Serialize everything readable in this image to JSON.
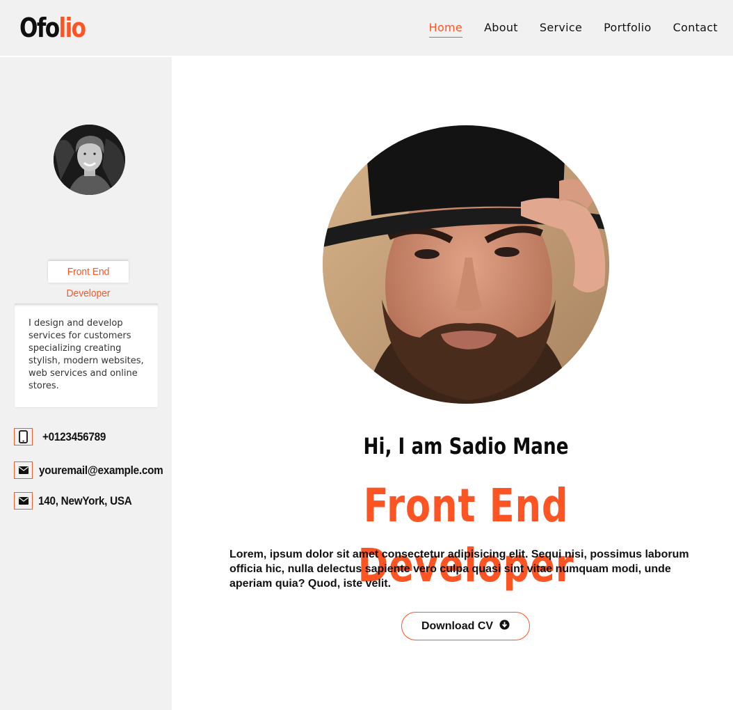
{
  "header": {
    "logo_part1": "Ofo",
    "logo_part2": "lio",
    "nav": [
      "Home",
      "About",
      "Service",
      "Portfolio",
      "Contact"
    ],
    "active_nav": "Home"
  },
  "sidebar": {
    "role": "Front End Developer",
    "bio": "I design and develop services for customers specializing creating stylish, modern websites, web services and online stores.",
    "contacts": [
      {
        "icon": "phone-icon",
        "text": "+0123456789"
      },
      {
        "icon": "envelope-icon",
        "text": "youremail@example.com"
      },
      {
        "icon": "envelope-icon",
        "text": "140, NewYork, USA"
      }
    ]
  },
  "hero": {
    "greeting": "Hi, I am Sadio Mane",
    "title": "Front End Developer",
    "description": "Lorem, ipsum dolor sit amet consectetur adipisicing elit. Sequi nisi, possimus laborum officia hic, nulla delectus sapiente vero culpa quasi sint vitae numquam modi, unde aperiam quia? Quod, iste velit.",
    "button_label": "Download CV",
    "button_icon": "download-circle-icon"
  },
  "colors": {
    "accent": "#fd5424",
    "panel": "#f1f1f1",
    "text": "#111111"
  }
}
